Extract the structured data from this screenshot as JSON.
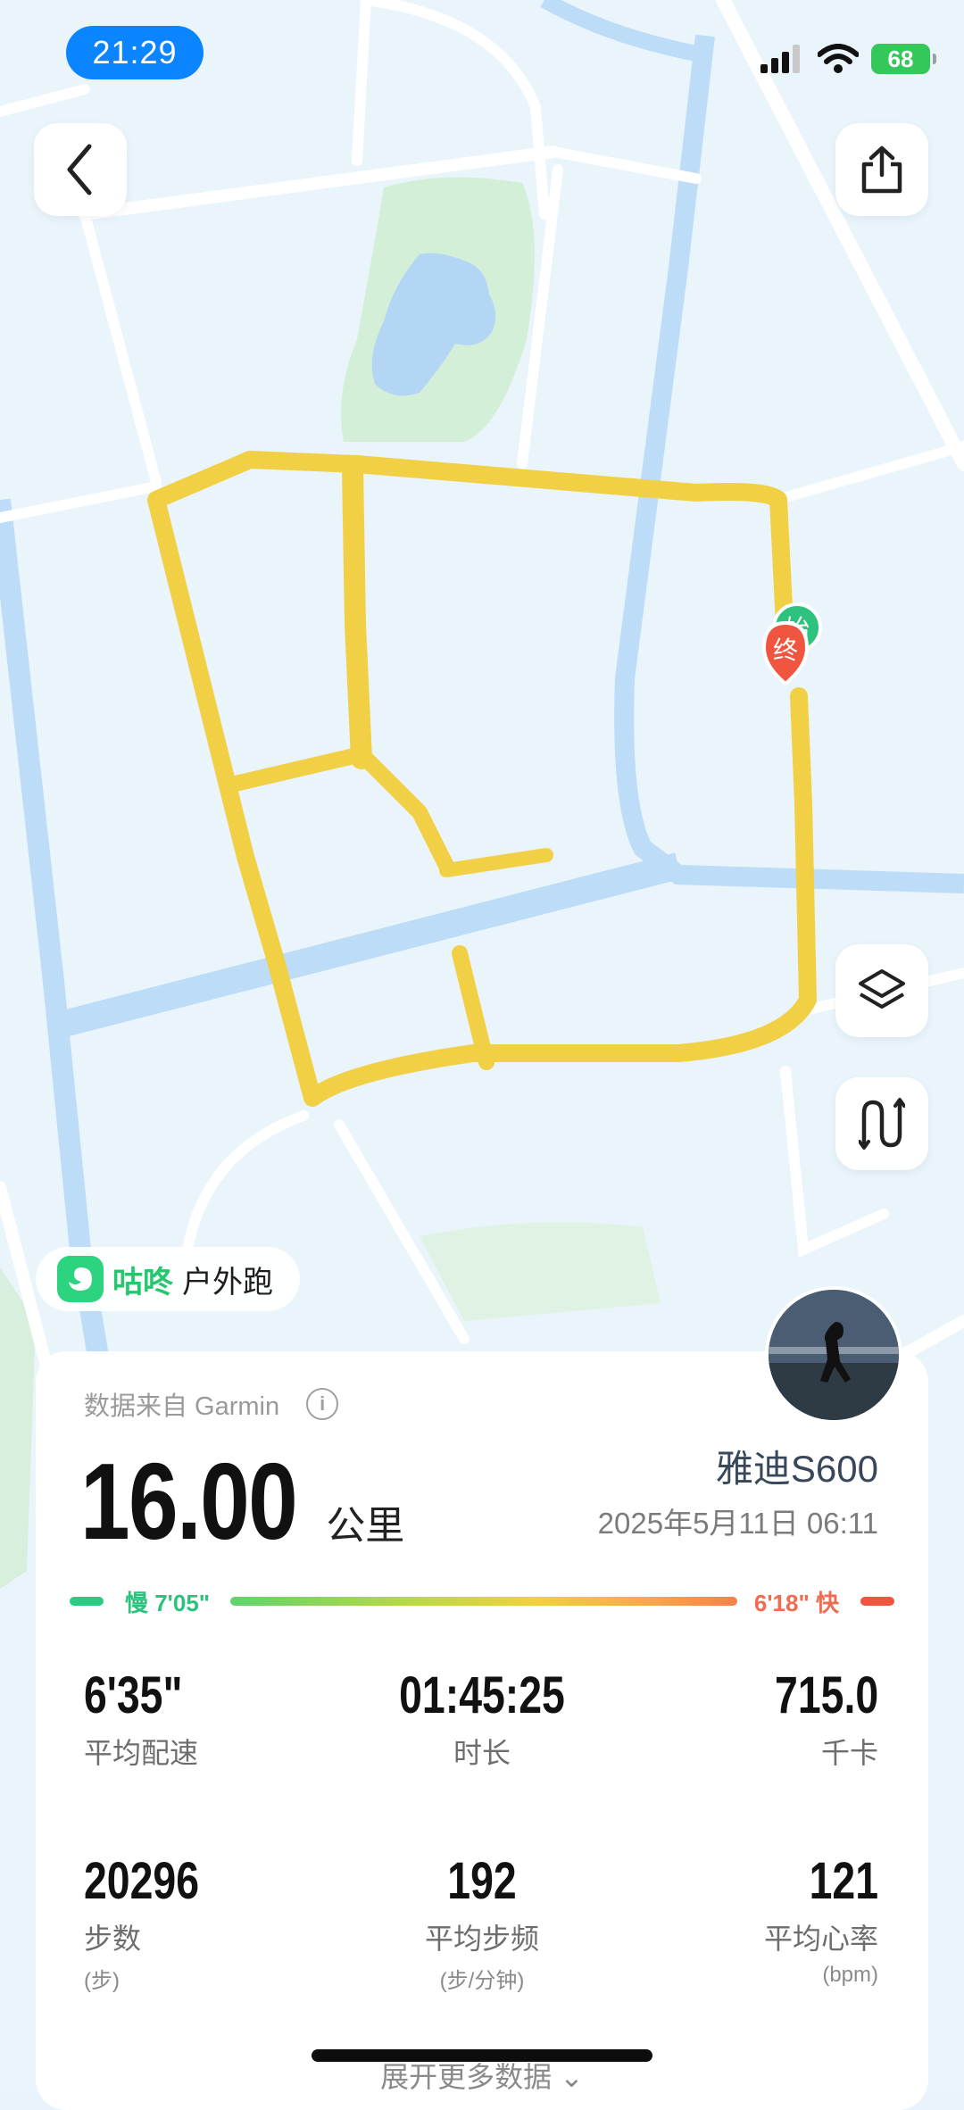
{
  "status_bar": {
    "time": "21:29",
    "battery": "68"
  },
  "route_markers": {
    "start": "始",
    "end": "终"
  },
  "badge": {
    "brand": "咕咚",
    "activity": "户外跑"
  },
  "card": {
    "source": "数据来自 Garmin",
    "distance_value": "16.00",
    "distance_unit": "公里",
    "device": "雅迪S600",
    "datetime": "2025年5月11日 06:11",
    "pace_slow": "慢 7'05\"",
    "pace_fast": "6'18\" 快",
    "stats": [
      {
        "value": "6'35\"",
        "label": "平均配速"
      },
      {
        "value": "01:45:25",
        "label": "时长"
      },
      {
        "value": "715.0",
        "label": "千卡"
      },
      {
        "value": "20296",
        "label": "步数",
        "unit": "(步)"
      },
      {
        "value": "192",
        "label": "平均步频",
        "unit": "(步/分钟)"
      },
      {
        "value": "121",
        "label": "平均心率",
        "unit": "(bpm)"
      }
    ],
    "expand": "展开更多数据"
  },
  "icons": {
    "back": "chevron-left-icon",
    "share": "share-icon",
    "layers": "layers-icon",
    "route_replay": "route-icon",
    "info": "info-icon",
    "expand": "chevron-down-icon"
  },
  "colors": {
    "route": "#f2d045",
    "water": "#bcdcf7",
    "park": "#d3efd8",
    "accent_green": "#2ac27d",
    "accent_red": "#f0553f",
    "time_pill": "#0a84ff"
  }
}
